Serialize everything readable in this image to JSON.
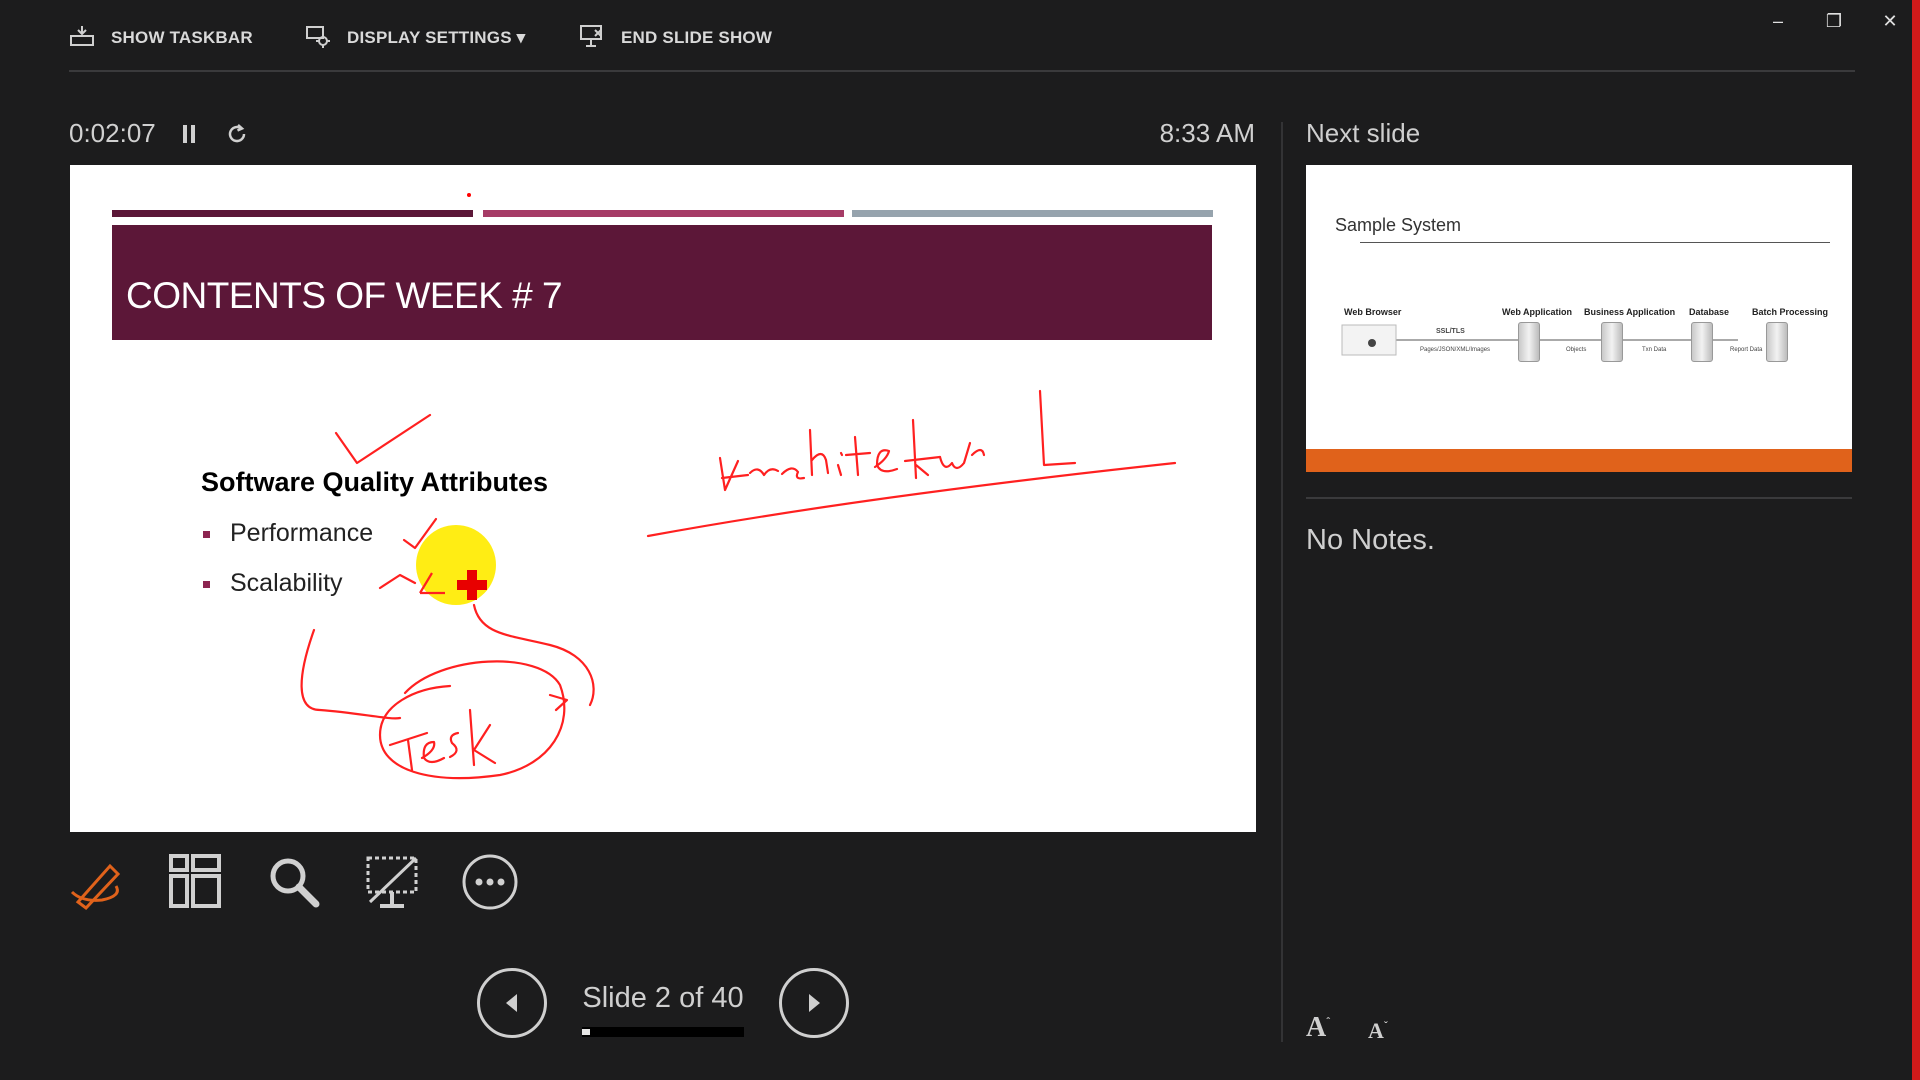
{
  "toolbar": {
    "show_taskbar": "SHOW TASKBAR",
    "display_settings": "DISPLAY SETTINGS ▾",
    "end_slide_show": "END SLIDE SHOW"
  },
  "window_controls": {
    "minimize": "–",
    "restore": "❐",
    "close": "✕"
  },
  "presenter": {
    "elapsed_time": "0:02:07",
    "clock": "8:33 AM",
    "slide_counter": "Slide 2 of 40",
    "progress_fraction": 0.05
  },
  "slide": {
    "title": "CONTENTS OF WEEK # 7",
    "heading": "Software Quality Attributes",
    "bullets": [
      "Performance",
      "Scalability"
    ],
    "accent_bars": [
      "#5c1738",
      "#a63b66",
      "#96a3ad"
    ]
  },
  "next_slide": {
    "label": "Next slide",
    "title": "Sample System",
    "diagram": {
      "nodes": [
        "Web Browser",
        "Web Application",
        "Business Application",
        "Database",
        "Batch Processing"
      ],
      "links": [
        "SSL/TLS",
        "Pages/JSON/XML/Images",
        "Objects",
        "Txn Data",
        "Report Data"
      ]
    }
  },
  "notes": {
    "text": "No Notes."
  },
  "font_buttons": {
    "increase": "A",
    "decrease": "A"
  },
  "icons": {
    "taskbar": "taskbar-icon",
    "display": "display-settings-icon",
    "end": "end-show-icon",
    "pause": "pause-icon",
    "reset": "reset-icon",
    "pen": "pen-icon",
    "grid": "see-all-slides-icon",
    "zoom": "magnifier-icon",
    "black_screen": "black-screen-icon",
    "more": "more-options-icon"
  },
  "colors": {
    "accent": "#e0621b",
    "ink": "#ff0000",
    "laser": "#ffeb00"
  }
}
